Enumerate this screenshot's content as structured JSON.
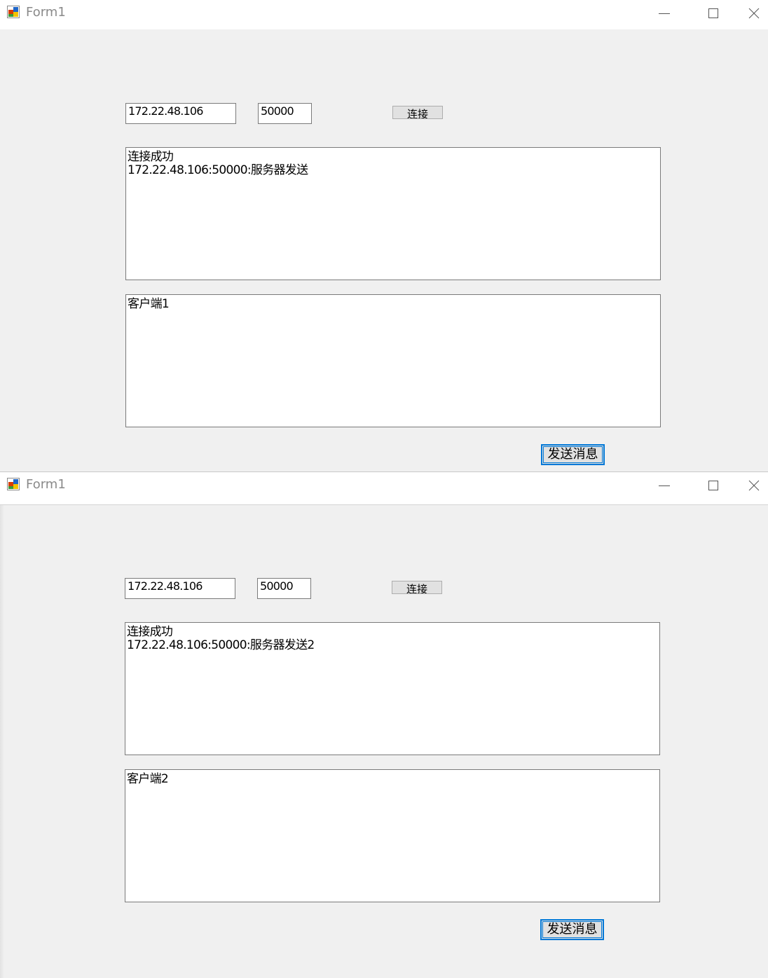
{
  "windows": [
    {
      "title": "Form1",
      "ip": "172.22.48.106",
      "port": "50000",
      "connect_label": "连接",
      "log_lines": [
        "连接成功",
        "172.22.48.106:50000:服务器发送"
      ],
      "message": "客户端1",
      "send_label": "发送消息"
    },
    {
      "title": "Form1",
      "ip": "172.22.48.106",
      "port": "50000",
      "connect_label": "连接",
      "log_lines": [
        "连接成功",
        "172.22.48.106:50000:服务器发送2"
      ],
      "message": "客户端2",
      "send_label": "发送消息"
    }
  ],
  "icons": {
    "app": "winforms-app-icon",
    "minimize": "minimize-icon",
    "maximize": "maximize-icon",
    "close": "close-icon"
  },
  "colors": {
    "accent": "#0078d7",
    "window_bg": "#f0f0f0",
    "titlebar_bg": "#ffffff"
  }
}
